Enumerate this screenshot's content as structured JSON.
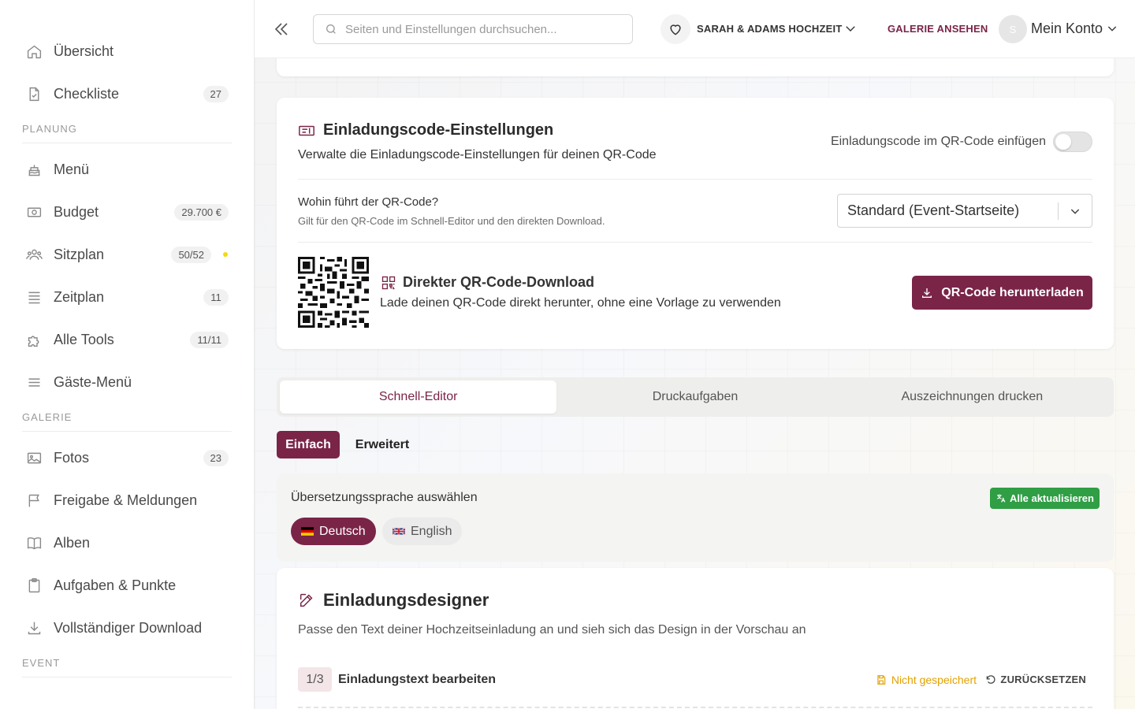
{
  "sidebar": {
    "items_top": [
      {
        "label": "Übersicht",
        "icon": "home-icon",
        "badge": ""
      },
      {
        "label": "Checkliste",
        "icon": "checklist-icon",
        "badge": "27"
      }
    ],
    "sections": [
      {
        "label": "PLANUNG",
        "items": [
          {
            "label": "Menü",
            "icon": "cake-icon",
            "badge": ""
          },
          {
            "label": "Budget",
            "icon": "money-icon",
            "badge": "29.700 €"
          },
          {
            "label": "Sitzplan",
            "icon": "users-icon",
            "badge": "50/52"
          },
          {
            "label": "Zeitplan",
            "icon": "list-icon",
            "badge": "11"
          },
          {
            "label": "Alle Tools",
            "icon": "puzzle-icon",
            "badge": "11/11"
          },
          {
            "label": "Gäste-Menü",
            "icon": "menu-icon",
            "badge": ""
          }
        ]
      },
      {
        "label": "GALERIE",
        "items": [
          {
            "label": "Fotos",
            "icon": "image-icon",
            "badge": "23"
          },
          {
            "label": "Freigabe & Meldungen",
            "icon": "flag-icon",
            "badge": ""
          },
          {
            "label": "Alben",
            "icon": "book-icon",
            "badge": ""
          },
          {
            "label": "Aufgaben & Punkte",
            "icon": "clipboard-icon",
            "badge": ""
          },
          {
            "label": "Vollständiger Download",
            "icon": "download-icon",
            "badge": ""
          }
        ]
      },
      {
        "label": "EVENT",
        "items": []
      }
    ]
  },
  "topbar": {
    "search_placeholder": "Seiten und Einstellungen durchsuchen...",
    "event_name": "SARAH & ADAMS HOCHZEIT",
    "gallery_link": "GALERIE ANSEHEN",
    "avatar_initial": "S",
    "account_label": "Mein Konto"
  },
  "qr_card": {
    "title": "Einladungscode-Einstellungen",
    "subtitle": "Verwalte die Einladungscode-Einstellungen für deinen QR-Code",
    "toggle_label": "Einladungscode im QR-Code einfügen",
    "toggle_on": false,
    "target_question": "Wohin führt der QR-Code?",
    "target_help": "Gilt für den QR-Code im Schnell-Editor und den direkten Download.",
    "target_selected": "Standard (Event-Startseite)",
    "download_title": "Direkter QR-Code-Download",
    "download_subtitle": "Lade deinen QR-Code direkt herunter, ohne eine Vorlage zu verwenden",
    "download_button": "QR-Code herunterladen"
  },
  "tabs": [
    {
      "label": "Schnell-Editor",
      "active": true
    },
    {
      "label": "Druckaufgaben",
      "active": false
    },
    {
      "label": "Auszeichnungen drucken",
      "active": false
    }
  ],
  "modes": {
    "simple": "Einfach",
    "advanced": "Erweitert"
  },
  "language": {
    "title": "Übersetzungssprache auswählen",
    "update_button": "Alle aktualisieren",
    "options": [
      {
        "label": "Deutsch",
        "selected": true
      },
      {
        "label": "English",
        "selected": false
      }
    ]
  },
  "designer": {
    "title": "Einladungsdesigner",
    "subtitle": "Passe den Text deiner Hochzeitseinladung an und sieh sich das Design in der Vorschau an",
    "step": "1/3",
    "step_label": "Einladungstext bearbeiten",
    "unsaved": "Nicht gespeichert",
    "reset": "ZURÜCKSETZEN"
  },
  "colors": {
    "accent": "#7a2448",
    "success": "#2f9e44",
    "warning": "#e3a100",
    "dot": "#f5d90a"
  }
}
